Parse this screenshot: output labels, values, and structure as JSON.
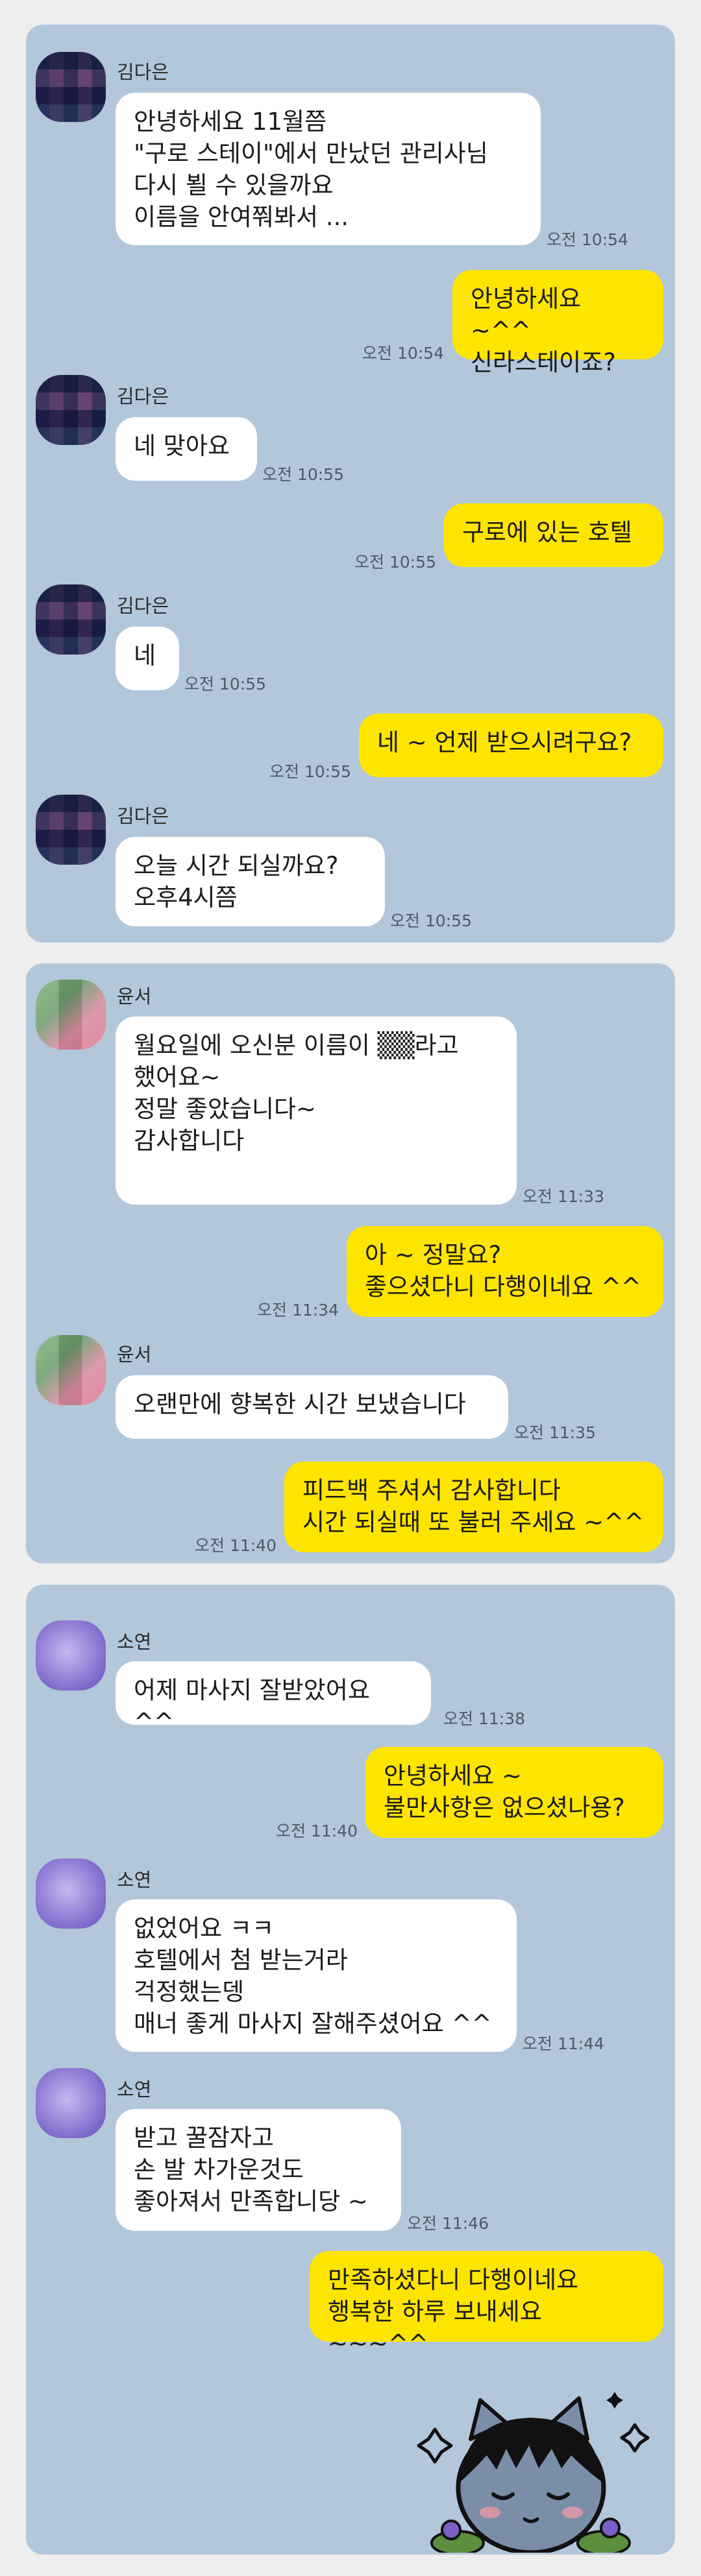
{
  "senders": {
    "s1": "김다은",
    "s2": "윤서",
    "s3": "소연"
  },
  "panel1": [
    {
      "text": "안녕하세요 11월쯤\n\"구로 스테이\"에서 만났던 관리사님\n다시 뵐 수 있을까요\n이름을 안여쭤봐서 ...",
      "time": "오전 10:54"
    },
    {
      "text": "안녕하세요 ~^^\n신라스테이죠?",
      "time": "오전 10:54"
    },
    {
      "text": "네 맞아요",
      "time": "오전 10:55"
    },
    {
      "text": "구로에 있는 호텔",
      "time": "오전 10:55"
    },
    {
      "text": "네",
      "time": "오전 10:55"
    },
    {
      "text": "네 ~ 언제 받으시려구요?",
      "time": "오전 10:55"
    },
    {
      "text": "오늘  시간 되실까요?\n오후4시쯤",
      "time": "오전 10:55"
    }
  ],
  "panel2": [
    {
      "text": "월요일에 오신분 이름이 ▒▒라고\n했어요~\n정말 좋았습니다~\n감사합니다",
      "time": "오전 11:33"
    },
    {
      "text": "아 ~ 정말요?\n좋으셨다니 다행이네요 ^^",
      "time": "오전 11:34"
    },
    {
      "text": "오랜만에 향복한 시간 보냈습니다",
      "time": "오전 11:35"
    },
    {
      "text": "피드백 주셔서 감사합니다\n시간 되실때 또 불러 주세요 ~^^",
      "time": "오전 11:40"
    }
  ],
  "panel3": [
    {
      "text": "어제 마사지 잘받았어요 ^^",
      "time": "오전 11:38"
    },
    {
      "text": "안녕하세요 ~\n불만사항은 없으셨나용?",
      "time": "오전 11:40"
    },
    {
      "text": "없었어요 ㅋㅋ\n호텔에서 첨 받는거라\n걱정했는뎅\n매너 좋게 마사지 잘해주셨어요 ^^",
      "time": "오전 11:44"
    },
    {
      "text": "받고 꿀잠자고\n손 발 차가운것도\n좋아져서 만족합니당 ~",
      "time": "오전 11:46"
    },
    {
      "text": "만족하셨다니 다행이네요\n행복한 하루 보내세요 ~~~^^",
      "time": ""
    }
  ],
  "colors": {
    "chat_background": "#b2c7da",
    "incoming_bubble": "#ffffff",
    "outgoing_bubble": "#fee500"
  }
}
